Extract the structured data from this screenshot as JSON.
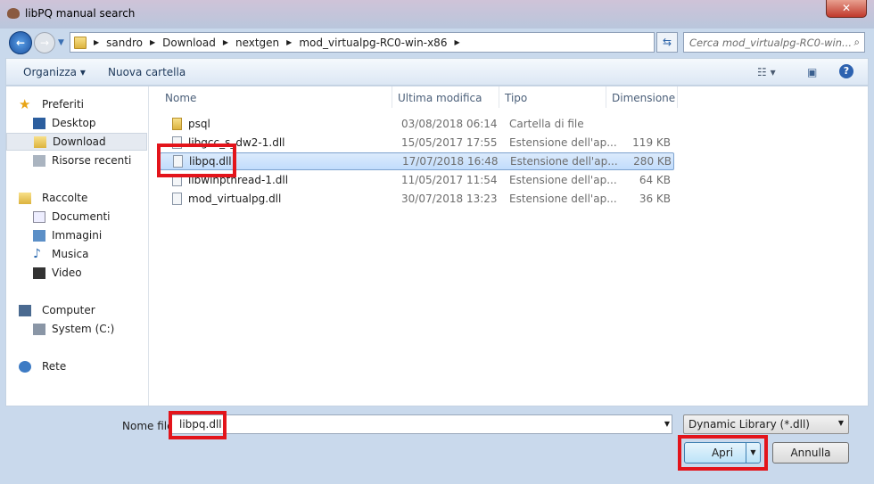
{
  "window": {
    "title": "libPQ manual search",
    "close_label": "✕"
  },
  "address": {
    "crumbs": [
      "sandro",
      "Download",
      "nextgen",
      "mod_virtualpg-RC0-win-x86"
    ]
  },
  "search": {
    "placeholder": "Cerca mod_virtualpg-RC0-win..."
  },
  "toolbar": {
    "organize": "Organizza ▾",
    "new_folder": "Nuova cartella"
  },
  "sidebar": {
    "items": [
      {
        "label": "Preferiti",
        "icon": "star-icon"
      },
      {
        "label": "Desktop",
        "icon": "desktop-icon"
      },
      {
        "label": "Download",
        "icon": "download-folder-icon",
        "selected": true
      },
      {
        "label": "Risorse recenti",
        "icon": "recent-icon"
      },
      {
        "label": "Raccolte",
        "icon": "libraries-icon"
      },
      {
        "label": "Documenti",
        "icon": "documents-icon"
      },
      {
        "label": "Immagini",
        "icon": "pictures-icon"
      },
      {
        "label": "Musica",
        "icon": "music-icon"
      },
      {
        "label": "Video",
        "icon": "video-icon"
      },
      {
        "label": "Computer",
        "icon": "computer-icon"
      },
      {
        "label": "System (C:)",
        "icon": "drive-icon"
      },
      {
        "label": "Rete",
        "icon": "network-icon"
      }
    ]
  },
  "columns": [
    "Nome",
    "Ultima modifica",
    "Tipo",
    "Dimensione"
  ],
  "files": [
    {
      "name": "psql",
      "modified": "03/08/2018 06:14",
      "type": "Cartella di file",
      "size": "",
      "folder": true
    },
    {
      "name": "libgcc_s_dw2-1.dll",
      "modified": "15/05/2017 17:55",
      "type": "Estensione dell'ap...",
      "size": "119 KB"
    },
    {
      "name": "libpq.dll",
      "modified": "17/07/2018 16:48",
      "type": "Estensione dell'ap...",
      "size": "280 KB",
      "selected": true
    },
    {
      "name": "libwinpthread-1.dll",
      "modified": "11/05/2017 11:54",
      "type": "Estensione dell'ap...",
      "size": "64 KB"
    },
    {
      "name": "mod_virtualpg.dll",
      "modified": "30/07/2018 13:23",
      "type": "Estensione dell'ap...",
      "size": "36 KB"
    }
  ],
  "footer": {
    "filename_label": "Nome file:",
    "filename_value": "libpq.dll",
    "filter": "Dynamic Library (*.dll)",
    "open": "Apri",
    "cancel": "Annulla"
  },
  "colors": {
    "highlight": "#e3141b",
    "selection": "#c1dcfc"
  }
}
